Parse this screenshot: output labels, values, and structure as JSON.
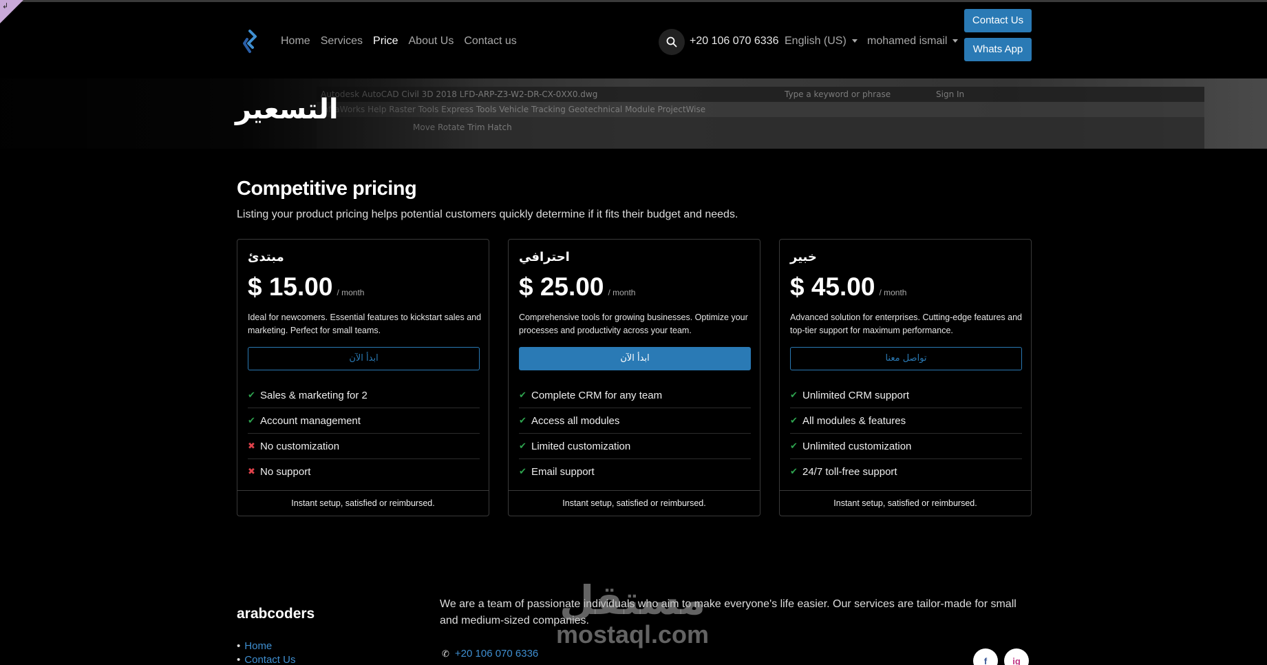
{
  "header": {
    "nav": [
      "Home",
      "Services",
      "Price",
      "About Us",
      "Contact us"
    ],
    "phone": "+20 106 070 6336",
    "language": "English (US)",
    "user": "mohamed ismail",
    "contact_button": "Contact Us",
    "whatsapp_button": "Whats App"
  },
  "banner": {
    "title": "التسعير",
    "background_texts": [
      "Autodesk AutoCAD Civil 3D 2018 LFD-ARP-Z3-W2-DR-CX-0XX0.dwg",
      "InfraWorks   Help   Raster Tools   Express Tools   Vehicle Tracking   Geotechnical Module   ProjectWise",
      "Move   Rotate   Trim   Hatch",
      "Type a keyword or phrase",
      "Sign In"
    ]
  },
  "pricing": {
    "title": "Competitive pricing",
    "subtitle": "Listing your product pricing helps potential customers quickly determine if it fits their budget and needs.",
    "plans": [
      {
        "name": "مبتدئ",
        "price": "$ 15.00",
        "period": "/ month",
        "description": "Ideal for newcomers. Essential features to kickstart sales and marketing. Perfect for small teams.",
        "button": "ابدأ الآن",
        "features": [
          {
            "text": "Sales & marketing for 2",
            "included": true
          },
          {
            "text": "Account management",
            "included": true
          },
          {
            "text": "No customization",
            "included": false
          },
          {
            "text": "No support",
            "included": false
          }
        ],
        "footer": "Instant setup, satisfied or reimbursed."
      },
      {
        "name": "احترافي",
        "price": "$ 25.00",
        "period": "/ month",
        "description": "Comprehensive tools for growing businesses. Optimize your processes and productivity across your team.",
        "button": "ابدأ الآن",
        "features": [
          {
            "text": "Complete CRM for any team",
            "included": true
          },
          {
            "text": "Access all modules",
            "included": true
          },
          {
            "text": "Limited customization",
            "included": true
          },
          {
            "text": "Email support",
            "included": true
          }
        ],
        "footer": "Instant setup, satisfied or reimbursed."
      },
      {
        "name": "خبير",
        "price": "$ 45.00",
        "period": "/ month",
        "description": "Advanced solution for enterprises. Cutting-edge features and top-tier support for maximum performance.",
        "button": "تواصل معنا",
        "features": [
          {
            "text": "Unlimited CRM support",
            "included": true
          },
          {
            "text": "All modules & features",
            "included": true
          },
          {
            "text": "Unlimited customization",
            "included": true
          },
          {
            "text": "24/7 toll-free support",
            "included": true
          }
        ],
        "footer": "Instant setup, satisfied or reimbursed."
      }
    ]
  },
  "footer": {
    "brand": "arabcoders",
    "links": [
      "Home",
      "Contact Us"
    ],
    "about": "We are a team of passionate individuals who aim to make everyone's life easier. Our services are tailor-made for small and medium-sized companies.",
    "phone": "+20 106 070 6336",
    "social": [
      "f",
      "ig"
    ]
  },
  "watermark": {
    "arabic": "مستقل",
    "latin": "mostaql.com"
  },
  "colors": {
    "accent": "#2a7ab5",
    "check": "#2ea44f",
    "cross": "#e0424b",
    "background": "#000000"
  }
}
